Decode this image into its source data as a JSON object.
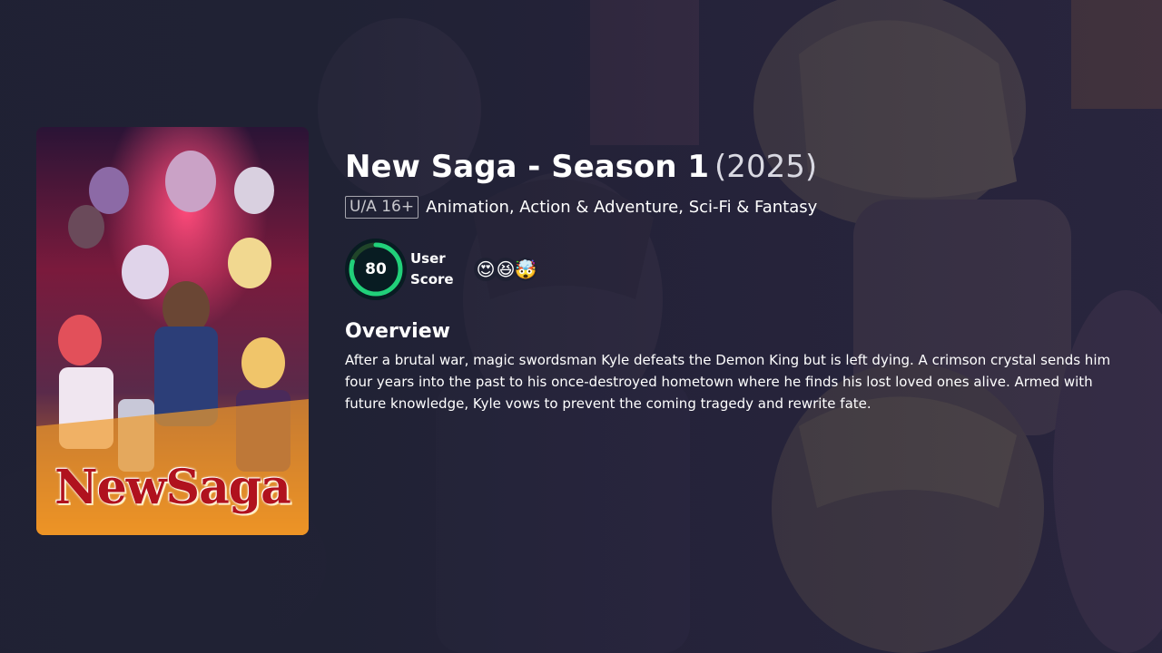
{
  "title": {
    "name": "New Saga - Season 1",
    "year": "(2025)"
  },
  "facts": {
    "certification": "U/A 16+",
    "genres": "Animation, Action & Adventure, Sci-Fi & Fantasy"
  },
  "score": {
    "value": "80",
    "percent": 80,
    "label_line1": "User",
    "label_line2": "Score",
    "ring_color": "#21d07a",
    "track_color": "#204529"
  },
  "reactions": [
    "😍",
    "😆",
    "🤯"
  ],
  "overview": {
    "heading": "Overview",
    "text": "After a brutal war, magic swordsman Kyle defeats the Demon King but is left dying. A crimson crystal sends him four years into the past to his once-destroyed hometown where he finds his lost loved ones alive. Armed with future knowledge, Kyle vows to prevent the coming tragedy and rewrite fate."
  },
  "poster": {
    "logo_text": "NewSaga"
  },
  "colors": {
    "background": "#1f2133",
    "accent_green": "#21d07a"
  }
}
